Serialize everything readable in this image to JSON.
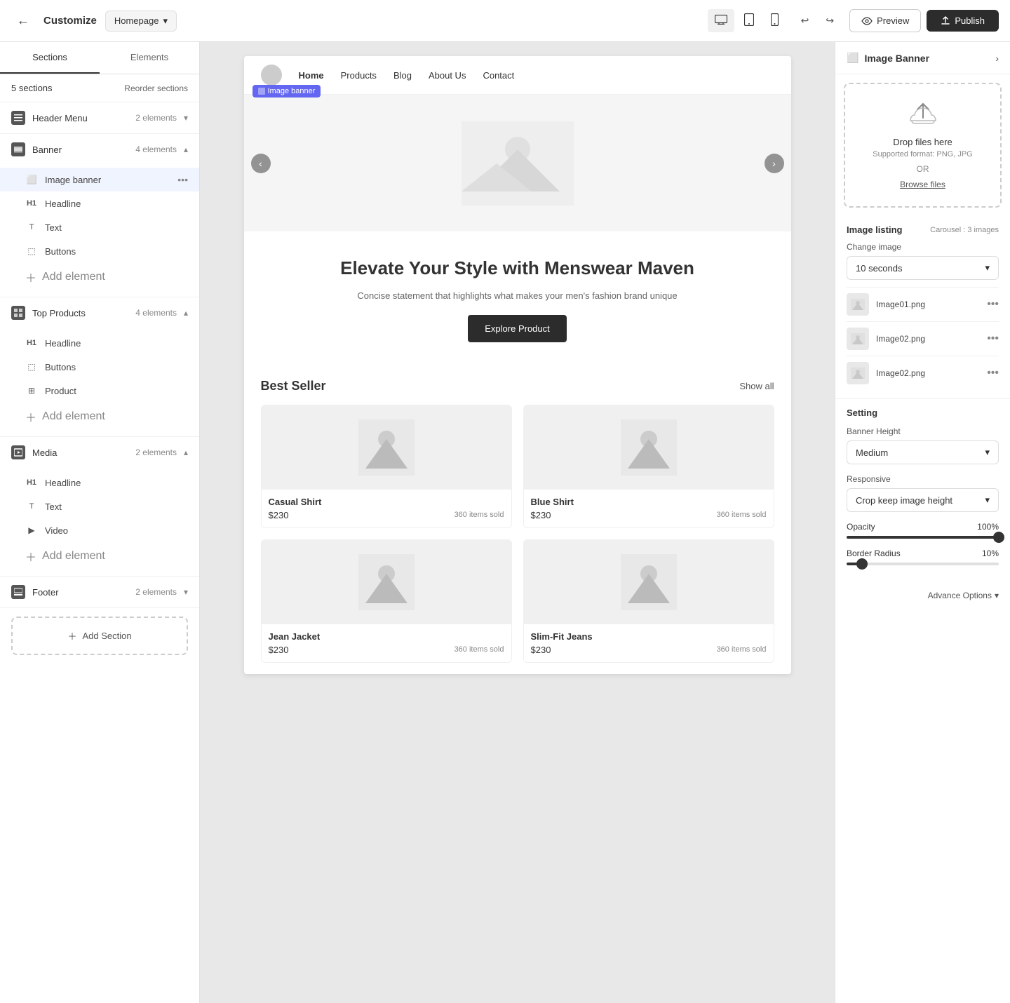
{
  "topbar": {
    "back_icon": "←",
    "title": "Customize",
    "page_label": "Homepage",
    "chevron": "▾",
    "device_desktop": "⬜",
    "device_tablet": "⬜",
    "device_mobile": "⬜",
    "undo": "↩",
    "redo": "↪",
    "preview_label": "Preview",
    "publish_label": "Publish"
  },
  "left_panel": {
    "tab_sections": "Sections",
    "tab_elements": "Elements",
    "sections_count": "5 sections",
    "reorder_label": "Reorder sections",
    "sections": [
      {
        "id": "header-menu",
        "name": "Header Menu",
        "elements_count": "2 elements",
        "expanded": false,
        "children": []
      },
      {
        "id": "banner",
        "name": "Banner",
        "elements_count": "4 elements",
        "expanded": true,
        "children": [
          {
            "type": "image-banner",
            "label": "Image banner",
            "highlighted": true
          },
          {
            "type": "headline",
            "label": "Headline",
            "highlighted": false
          },
          {
            "type": "text",
            "label": "Text",
            "highlighted": false
          },
          {
            "type": "buttons",
            "label": "Buttons",
            "highlighted": false
          }
        ],
        "add_element": "Add element"
      },
      {
        "id": "top-products",
        "name": "Top Products",
        "elements_count": "4 elements",
        "expanded": true,
        "children": [
          {
            "type": "headline",
            "label": "Headline",
            "highlighted": false
          },
          {
            "type": "buttons",
            "label": "Buttons",
            "highlighted": false
          },
          {
            "type": "product",
            "label": "Product",
            "highlighted": false
          }
        ],
        "add_element": "Add element"
      },
      {
        "id": "media",
        "name": "Media",
        "elements_count": "2 elements",
        "expanded": true,
        "children": [
          {
            "type": "headline",
            "label": "Headline",
            "highlighted": false
          },
          {
            "type": "text",
            "label": "Text",
            "highlighted": false
          },
          {
            "type": "video",
            "label": "Video",
            "highlighted": false
          }
        ],
        "add_element": "Add element"
      },
      {
        "id": "footer",
        "name": "Footer",
        "elements_count": "2 elements",
        "expanded": false,
        "children": []
      }
    ],
    "add_section_label": "Add Section"
  },
  "preview": {
    "nav": {
      "logo_alt": "Logo",
      "links": [
        "Home",
        "Products",
        "Blog",
        "About Us",
        "Contact"
      ]
    },
    "banner": {
      "label": "Image banner",
      "carousel_prev": "‹",
      "carousel_next": "›"
    },
    "hero": {
      "title": "Elevate Your Style with Menswear Maven",
      "subtitle": "Concise statement that highlights what makes your men's fashion brand unique",
      "cta_label": "Explore Product"
    },
    "products": {
      "title": "Best Seller",
      "show_all": "Show all",
      "items": [
        {
          "name": "Casual Shirt",
          "price": "$230",
          "sold": "360 items sold"
        },
        {
          "name": "Blue Shirt",
          "price": "$230",
          "sold": "360 items sold"
        },
        {
          "name": "Jean Jacket",
          "price": "$230",
          "sold": "360 items sold"
        },
        {
          "name": "Slim-Fit Jeans",
          "price": "$230",
          "sold": "360 items sold"
        }
      ]
    }
  },
  "right_panel": {
    "title": "Image Banner",
    "nav_icon": "›",
    "drop_zone": {
      "upload_icon": "⬆",
      "title": "Drop files here",
      "format": "Supported format: PNG, JPG",
      "or_label": "OR",
      "browse_label": "Browse files"
    },
    "image_listing": {
      "title": "Image listing",
      "carousel_info": "Carousel : 3 images",
      "change_image_label": "Change image",
      "interval_value": "10 seconds",
      "images": [
        {
          "filename": "Image01.png"
        },
        {
          "filename": "Image02.png"
        },
        {
          "filename": "Image02.png"
        }
      ]
    },
    "settings": {
      "title": "Setting",
      "banner_height_label": "Banner Height",
      "banner_height_value": "Medium",
      "responsive_label": "Responsive",
      "responsive_value": "Crop keep image height",
      "opacity_label": "Opacity",
      "opacity_value": "100%",
      "opacity_percent": 100,
      "border_radius_label": "Border Radius",
      "border_radius_value": "10%",
      "border_radius_percent": 10,
      "advance_options": "Advance Options"
    }
  }
}
